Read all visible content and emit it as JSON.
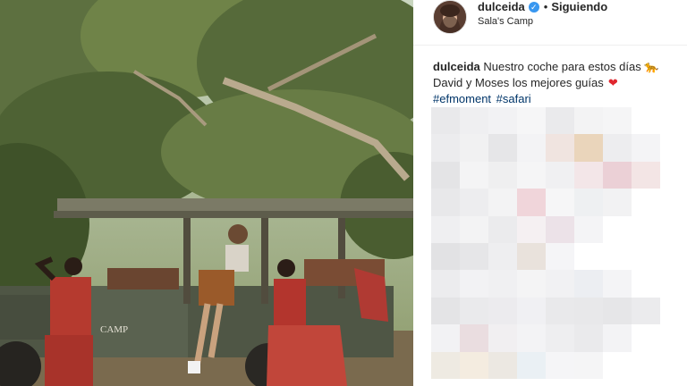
{
  "photo": {
    "vehicle_sign": "CAMP",
    "description_icon": "safari-photo"
  },
  "post": {
    "username": "dulceida",
    "follow_separator": "•",
    "follow_label": "Siguiendo",
    "location": "Sala's Camp"
  },
  "caption": {
    "username": "dulceida",
    "text_line1": "Nuestro coche para estos días",
    "emoji1": "🐆",
    "text_line2": "David y Moses los mejores guías",
    "emoji2": "❤",
    "hashtags": [
      "#efmoment",
      "#safari"
    ]
  },
  "comments_blur_colors": [
    "#e9e9eb",
    "#efeff1",
    "#f2f2f4",
    "#f6f6f7",
    "#eaeaec",
    "#f3f3f4",
    "#f5f5f6",
    "#ffffff",
    "#ececee",
    "#f1f1f2",
    "#e6e6e8",
    "#f3f3f5",
    "#f0e4e0",
    "#ead5bb",
    "#ededef",
    "#f4f4f6",
    "#e4e4e6",
    "#f4f4f5",
    "#efeff0",
    "#f5f5f6",
    "#f0f0f2",
    "#f3e6e8",
    "#ebd0d6",
    "#f3e5e5",
    "#e8e8ea",
    "#ededef",
    "#f3f3f4",
    "#f0d5da",
    "#f6f6f7",
    "#eef0f2",
    "#f2f2f3",
    "#ffffff",
    "#efeff1",
    "#f3f3f4",
    "#ebebed",
    "#f5f0f2",
    "#ece2e8",
    "#f4f4f6",
    "#ffffff",
    "#ffffff",
    "#e2e2e4",
    "#e6e6e8",
    "#eeeef0",
    "#e9e2dc",
    "#f5f5f7",
    "#ffffff",
    "#ffffff",
    "#ffffff",
    "#ececee",
    "#f2f2f4",
    "#f0f0f2",
    "#f4f4f5",
    "#f1f1f3",
    "#eceef2",
    "#f4f4f6",
    "#ffffff",
    "#e4e4e6",
    "#eaeaec",
    "#ecebee",
    "#f0f0f3",
    "#e9e9eb",
    "#e8e8ea",
    "#e6e6e8",
    "#ebebed",
    "#f2f2f4",
    "#eadde0",
    "#f1eff1",
    "#f3f3f5",
    "#eeeef0",
    "#eaeaec",
    "#f3f3f5",
    "#ffffff",
    "#eeeae2",
    "#f4ece0",
    "#ece8e2",
    "#eaf0f4",
    "#f5f5f7",
    "#f5f5f6",
    "#ffffff",
    "#ffffff"
  ]
}
